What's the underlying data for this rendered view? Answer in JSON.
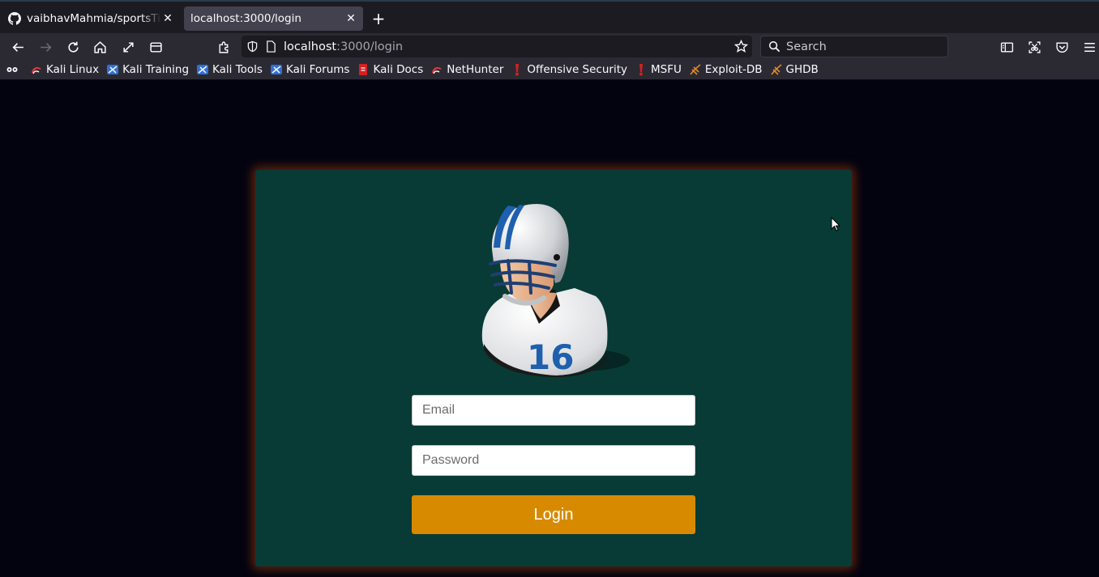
{
  "browser": {
    "tabs": [
      {
        "label": "vaibhavMahmia/sportsTick",
        "icon": "github-icon",
        "active": false
      },
      {
        "label": "localhost:3000/login",
        "icon": "",
        "active": true
      }
    ],
    "new_tab_symbol": "+",
    "close_symbol": "✕",
    "url": {
      "host": "localhost",
      "path": ":3000/login"
    },
    "search_placeholder": "Search",
    "bookmarks": [
      {
        "label": "",
        "icon": "kali-dragon-icon"
      },
      {
        "label": "Kali Linux",
        "icon": "kali-icon"
      },
      {
        "label": "Kali Training",
        "icon": "kali-training-icon"
      },
      {
        "label": "Kali Tools",
        "icon": "kali-tools-icon"
      },
      {
        "label": "Kali Forums",
        "icon": "kali-forums-icon"
      },
      {
        "label": "Kali Docs",
        "icon": "kali-docs-icon"
      },
      {
        "label": "NetHunter",
        "icon": "nethunter-icon"
      },
      {
        "label": "Offensive Security",
        "icon": "offsec-icon"
      },
      {
        "label": "MSFU",
        "icon": "msfu-icon"
      },
      {
        "label": "Exploit-DB",
        "icon": "exploitdb-icon"
      },
      {
        "label": "GHDB",
        "icon": "ghdb-icon"
      }
    ]
  },
  "login": {
    "avatar_number": "16",
    "email_placeholder": "Email",
    "password_placeholder": "Password",
    "button_label": "Login"
  },
  "colors": {
    "page_bg": "#03030f",
    "card_bg": "#083b35",
    "card_glow": "#a83e0c",
    "button_bg": "#d78a00",
    "helmet_stripe": "#1e5fae"
  }
}
